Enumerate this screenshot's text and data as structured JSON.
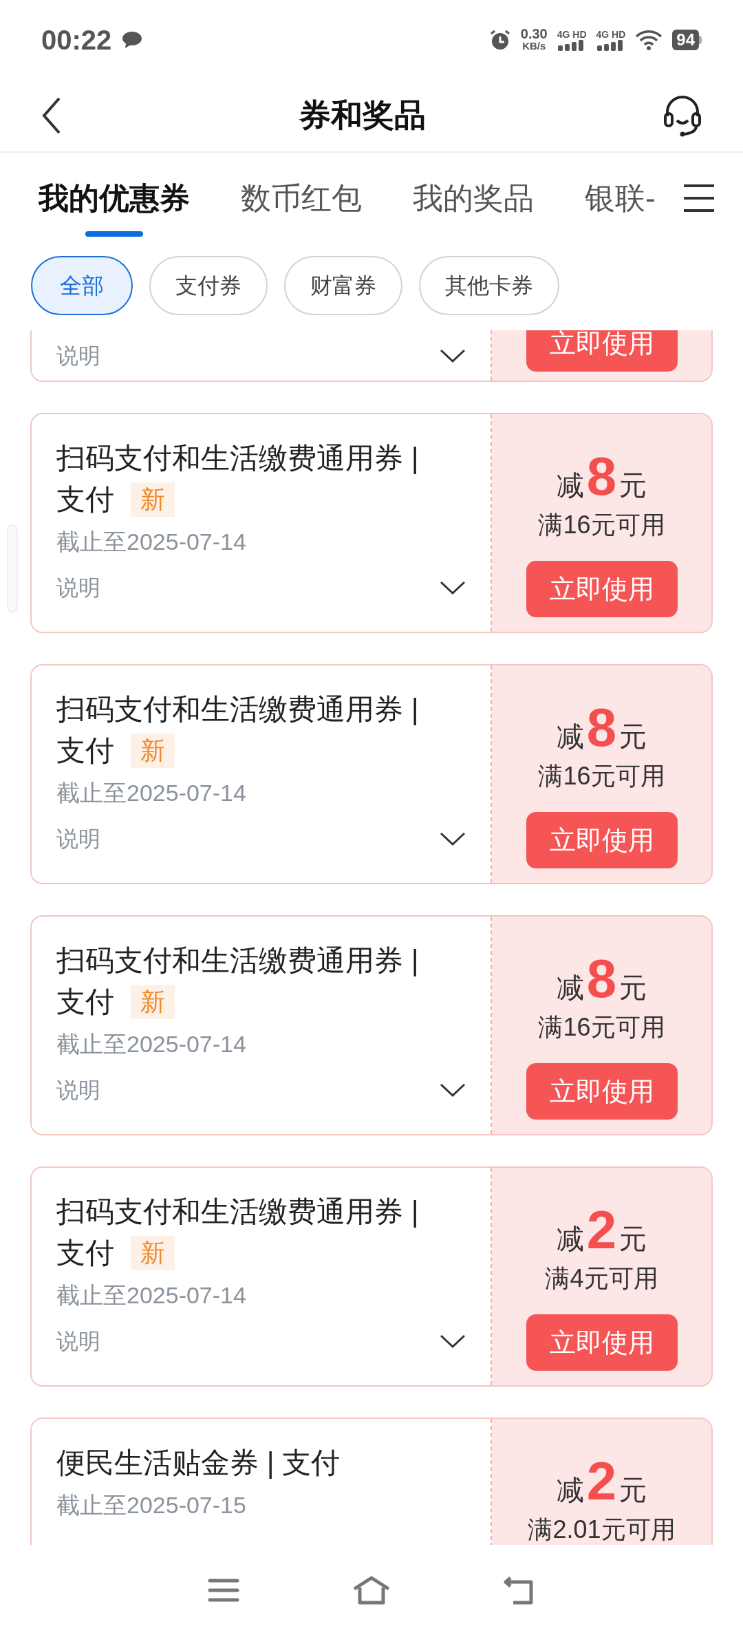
{
  "status_bar": {
    "time": "00:22",
    "net_speed": "0.30",
    "net_unit": "KB/s",
    "sim1": "4G HD",
    "sim2": "4G HD",
    "battery": "94"
  },
  "header": {
    "title": "券和奖品"
  },
  "tabs": [
    {
      "label": "我的优惠券",
      "selected": true
    },
    {
      "label": "数币红包",
      "selected": false
    },
    {
      "label": "我的奖品",
      "selected": false
    },
    {
      "label": "银联-",
      "selected": false
    }
  ],
  "filters": [
    {
      "label": "全部",
      "selected": true
    },
    {
      "label": "支付券",
      "selected": false
    },
    {
      "label": "财富券",
      "selected": false
    },
    {
      "label": "其他卡券",
      "selected": false
    }
  ],
  "coupons": [
    {
      "kind": "partial_top",
      "note": "说明",
      "button": "立即使用"
    },
    {
      "kind": "full",
      "title_lines": [
        "扫码支付和生活缴费通用券 |",
        "支付"
      ],
      "badge": "新",
      "expiry": "截止至2025-07-14",
      "note": "说明",
      "prefix": "减",
      "amount": "8",
      "unit": "元",
      "condition": "满16元可用",
      "button": "立即使用"
    },
    {
      "kind": "full",
      "title_lines": [
        "扫码支付和生活缴费通用券 |",
        "支付"
      ],
      "badge": "新",
      "expiry": "截止至2025-07-14",
      "note": "说明",
      "prefix": "减",
      "amount": "8",
      "unit": "元",
      "condition": "满16元可用",
      "button": "立即使用"
    },
    {
      "kind": "full",
      "title_lines": [
        "扫码支付和生活缴费通用券 |",
        "支付"
      ],
      "badge": "新",
      "expiry": "截止至2025-07-14",
      "note": "说明",
      "prefix": "减",
      "amount": "8",
      "unit": "元",
      "condition": "满16元可用",
      "button": "立即使用"
    },
    {
      "kind": "full",
      "title_lines": [
        "扫码支付和生活缴费通用券 |",
        "支付"
      ],
      "badge": "新",
      "expiry": "截止至2025-07-14",
      "note": "说明",
      "prefix": "减",
      "amount": "2",
      "unit": "元",
      "condition": "满4元可用",
      "button": "立即使用"
    },
    {
      "kind": "partial_bottom",
      "title_lines": [
        "便民生活贴金券 | 支付"
      ],
      "expiry": "截止至2025-07-15",
      "prefix": "减",
      "amount": "2",
      "unit": "元",
      "condition": "满2.01元可用"
    }
  ]
}
